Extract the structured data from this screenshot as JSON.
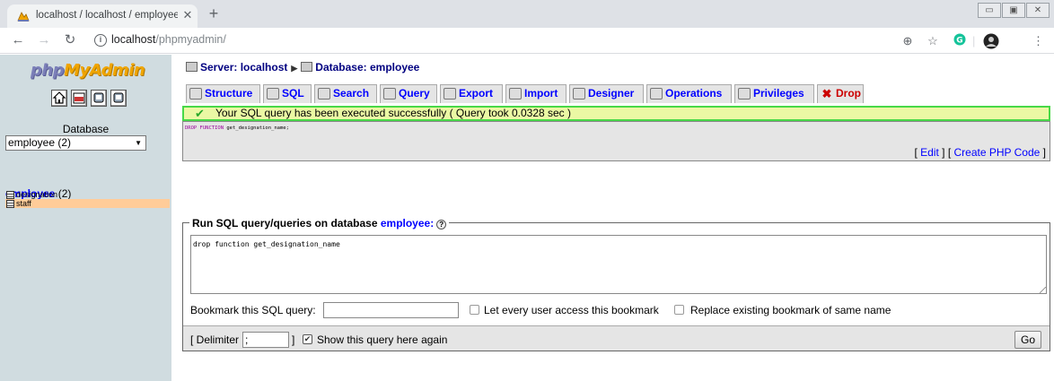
{
  "browser": {
    "tab_title": "localhost / localhost / employee",
    "tab_close": "✕",
    "new_tab": "+",
    "url_host": "localhost",
    "url_path": "/phpmyadmin/",
    "window_buttons": [
      "▭",
      "▣",
      "✕"
    ]
  },
  "left": {
    "logo_php": "php",
    "logo_myadmin": "MyAdmin",
    "db_label": "Database",
    "db_select": "employee (2)",
    "db_name": "employee",
    "db_count": "(2)",
    "tables": [
      {
        "name": "designation",
        "highlight": false
      },
      {
        "name": "staff",
        "highlight": true
      }
    ],
    "highlight_color": "#ffcc99"
  },
  "breadcrumb": {
    "server": "Server: localhost",
    "database": "Database: employee"
  },
  "tabs": [
    {
      "label": "Structure"
    },
    {
      "label": "SQL"
    },
    {
      "label": "Search"
    },
    {
      "label": "Query"
    },
    {
      "label": "Export"
    },
    {
      "label": "Import"
    },
    {
      "label": "Designer"
    },
    {
      "label": "Operations"
    },
    {
      "label": "Privileges"
    },
    {
      "label": "Drop"
    }
  ],
  "result": {
    "message": "Your SQL query has been executed successfully ( Query took 0.0328 sec )",
    "sql_keyword": "DROP FUNCTION",
    "sql_rest": " get_designation_name;",
    "edit_link": "Edit",
    "create_php_link": "Create PHP Code"
  },
  "query_form": {
    "legend_prefix": "Run SQL query/queries on database",
    "legend_db": "employee:",
    "help": "?",
    "query_text": "drop function get_designation_name",
    "bookmark_label": "Bookmark this SQL query:",
    "bookmark_value": "",
    "access_label": "Let every user access this bookmark",
    "replace_label": "Replace existing bookmark of same name",
    "delimiter_label": "[ Delimiter",
    "delimiter_value": ";",
    "delimiter_close": "]",
    "show_again_label": "Show this query here again",
    "show_again_checked": true,
    "go_label": "Go"
  },
  "colors": {
    "left_pane_bg": "#d0dce0",
    "success_bg": "#ebf8a4",
    "success_border": "#48d848",
    "link": "#0000ff"
  }
}
